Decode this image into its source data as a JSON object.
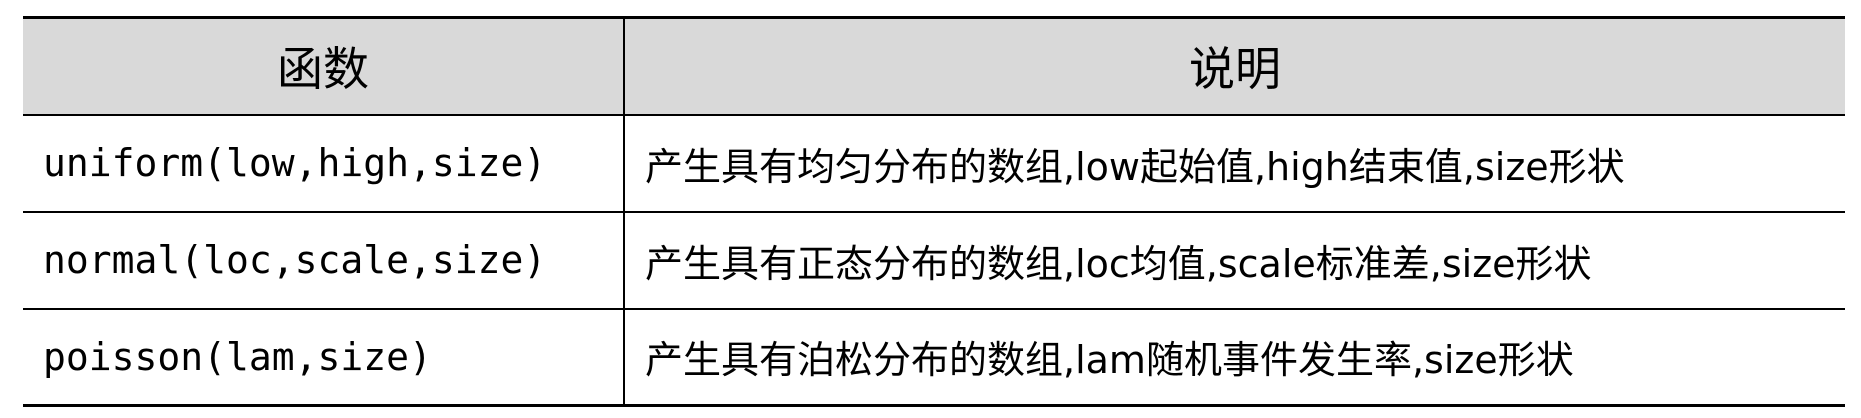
{
  "table": {
    "headers": [
      "函数",
      "说明"
    ],
    "rows": [
      {
        "function": "uniform(low,high,size)",
        "description": "产生具有均匀分布的数组,low起始值,high结束值,size形状"
      },
      {
        "function": "normal(loc,scale,size)",
        "description": "产生具有正态分布的数组,loc均值,scale标准差,size形状"
      },
      {
        "function": "poisson(lam,size)",
        "description": "产生具有泊松分布的数组,lam随机事件发生率,size形状"
      }
    ]
  },
  "colors": {
    "header_background": "#d9d9d9",
    "border": "#000000",
    "text": "#000000"
  }
}
